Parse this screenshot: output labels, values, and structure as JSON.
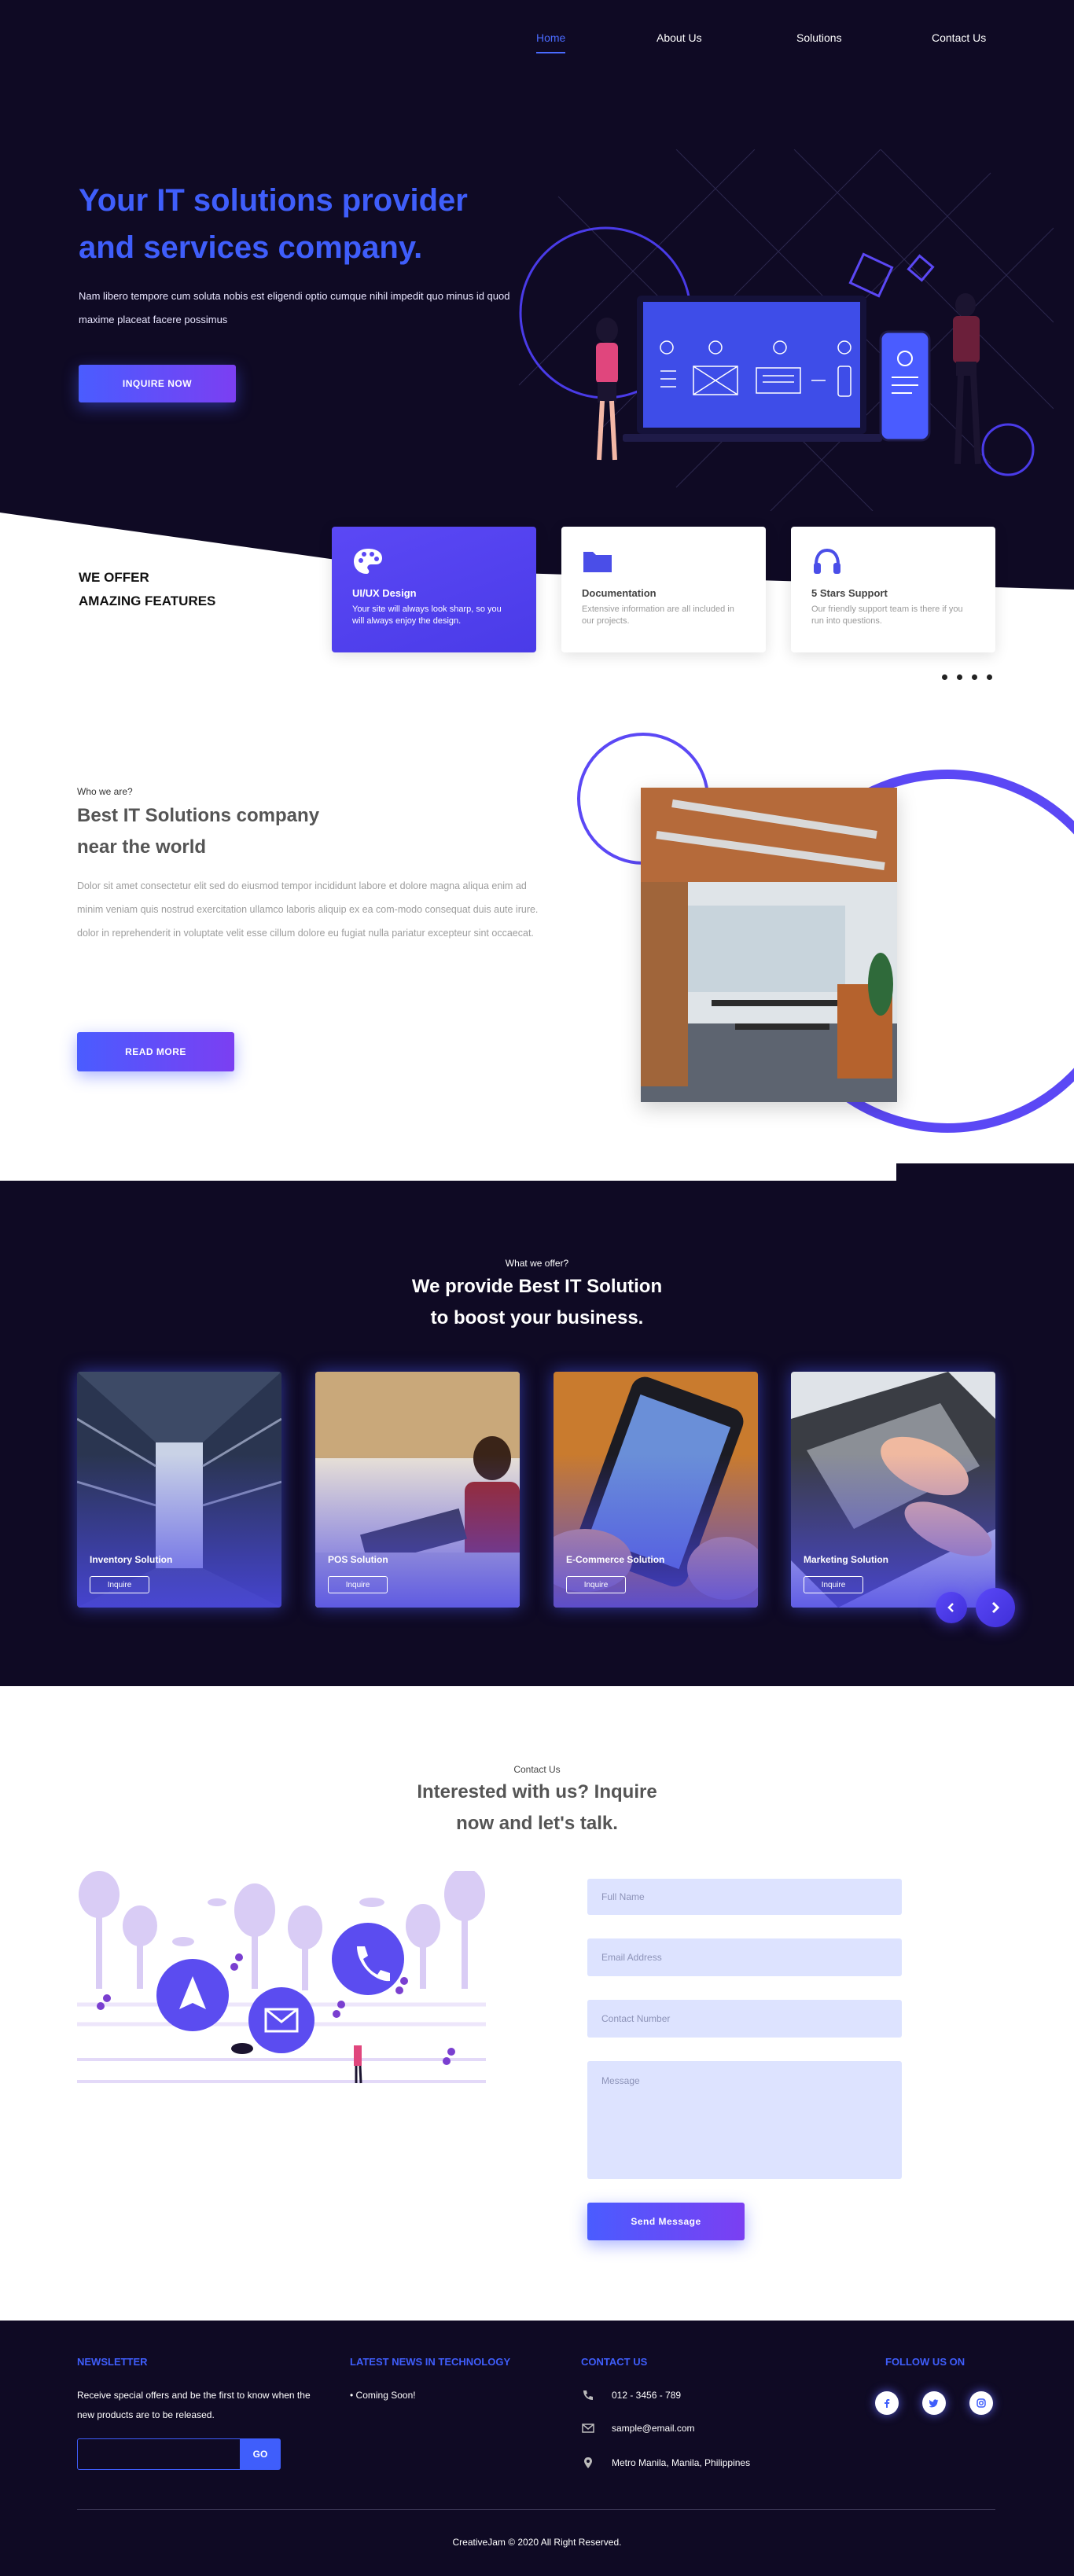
{
  "nav": {
    "items": [
      {
        "label": "Home",
        "active": true
      },
      {
        "label": "About Us",
        "active": false
      },
      {
        "label": "Solutions",
        "active": false
      },
      {
        "label": "Contact Us",
        "active": false
      }
    ]
  },
  "hero": {
    "title": "Your IT solutions provider and services company.",
    "subtitle": "Nam libero tempore cum soluta nobis est eligendi optio cumque nihil impedit quo minus id quod maxime placeat facere possimus",
    "cta": "INQUIRE NOW"
  },
  "features": {
    "heading_line1": "WE OFFER",
    "heading_line2": "AMAZING FEATURES",
    "cards": [
      {
        "icon": "palette-icon",
        "title": "UI/UX Design",
        "desc": "Your site will always look sharp, so you will always enjoy the design."
      },
      {
        "icon": "folder-icon",
        "title": "Documentation",
        "desc": "Extensive information are all included in our projects."
      },
      {
        "icon": "headphones-icon",
        "title": "5 Stars Support",
        "desc": "Our friendly support team is there if you run into questions."
      }
    ]
  },
  "about": {
    "small": "Who we are?",
    "title_line1": "Best IT Solutions company",
    "title_line2": "near the world",
    "text": "Dolor sit amet consectetur elit sed do eiusmod tempor incididunt labore et dolore magna aliqua enim ad minim veniam quis nostrud exercitation ullamco laboris aliquip ex ea com-modo consequat duis aute irure. dolor in reprehenderit in voluptate velit esse cillum dolore eu fugiat nulla pariatur excepteur sint occaecat.",
    "cta": "READ MORE"
  },
  "services": {
    "small": "What we offer?",
    "title_line1": "We provide Best IT Solution",
    "title_line2": "to boost your business.",
    "cards": [
      {
        "name": "Inventory Solution",
        "button": "Inquire"
      },
      {
        "name": "POS Solution",
        "button": "Inquire"
      },
      {
        "name": "E-Commerce Solution",
        "button": "Inquire"
      },
      {
        "name": "Marketing Solution",
        "button": "Inquire"
      }
    ]
  },
  "contact": {
    "small": "Contact Us",
    "title_line1": "Interested with us? Inquire",
    "title_line2": "now and let's talk.",
    "placeholders": {
      "name": "Full Name",
      "email": "Email Address",
      "phone": "Contact Number",
      "message": "Message"
    },
    "submit": "Send Message"
  },
  "footer": {
    "newsletter": {
      "heading": "NEWSLETTER",
      "text": "Receive special offers and be the first to know when the new products are to be released.",
      "button": "GO"
    },
    "news": {
      "heading": "LATEST NEWS IN TECHNOLOGY",
      "item": "• Coming Soon!"
    },
    "contact": {
      "heading": "CONTACT US",
      "phone": "012 - 3456 - 789",
      "email": "sample@email.com",
      "address": "Metro Manila, Manila, Philippines"
    },
    "follow": {
      "heading": "FOLLOW US ON",
      "icons": [
        "facebook-icon",
        "twitter-icon",
        "instagram-icon"
      ]
    },
    "copyright": "CreativeJam © 2020 All Right Reserved."
  },
  "colors": {
    "dark_bg": "#0f0a24",
    "accent": "#3f5efb",
    "purple": "#7b3ff2",
    "field_bg": "#dde3ff"
  }
}
